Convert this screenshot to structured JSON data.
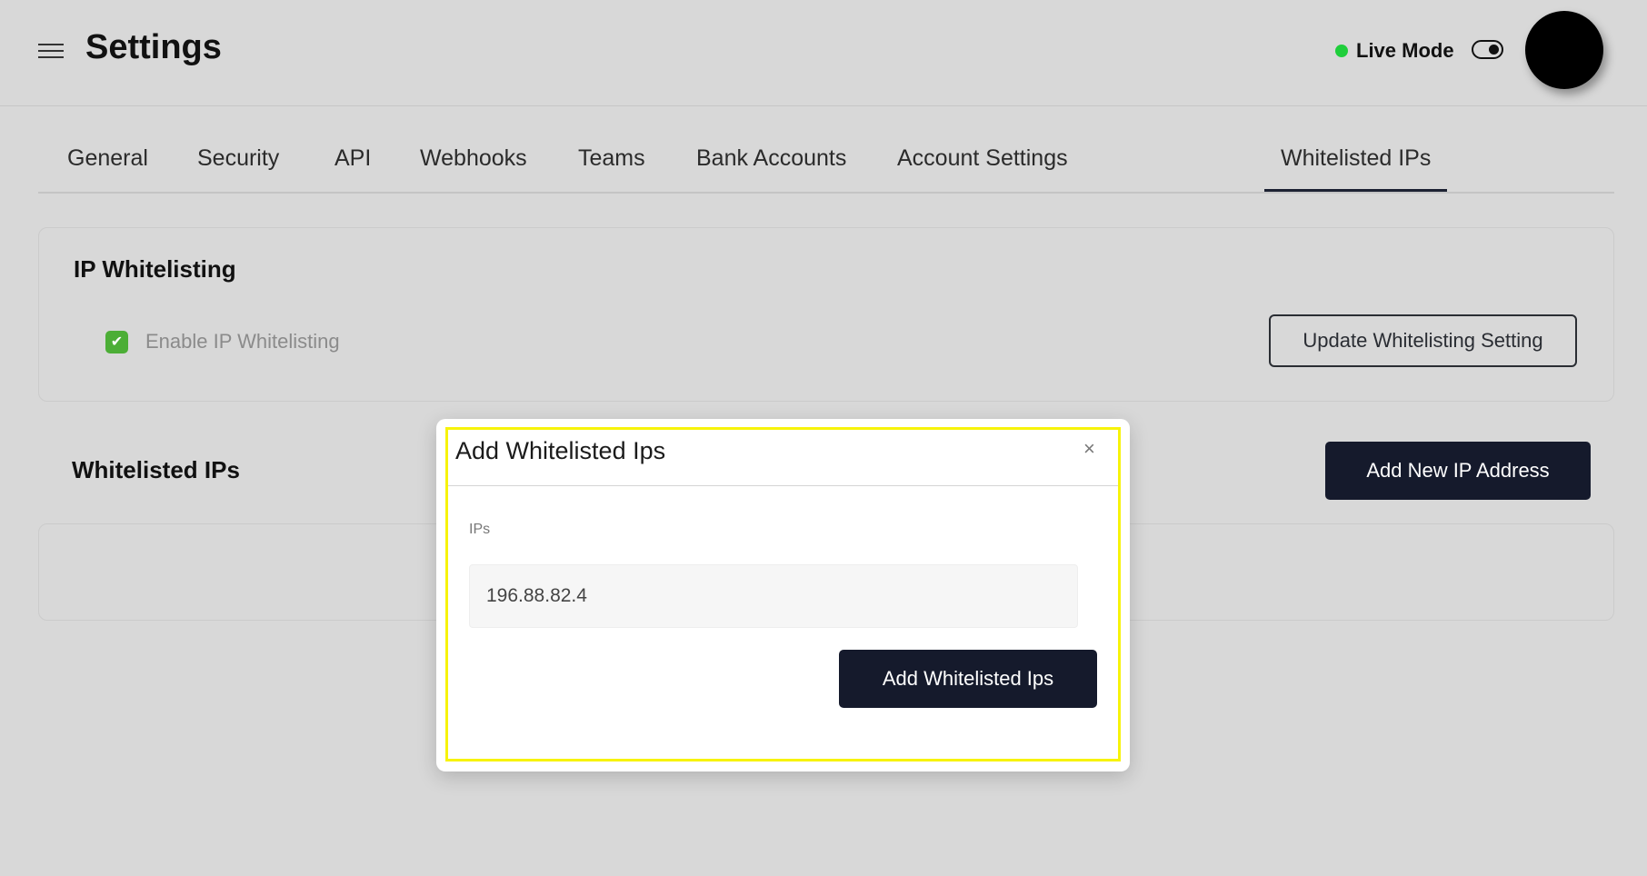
{
  "header": {
    "title": "Settings",
    "menu_icon": "hamburger-menu-icon",
    "live_mode_label": "Live Mode",
    "live_mode_status_color": "#1fce3b",
    "live_mode_on": true
  },
  "tabs": [
    {
      "label": "General",
      "active": false
    },
    {
      "label": "Security",
      "active": false
    },
    {
      "label": "API",
      "active": false
    },
    {
      "label": "Webhooks",
      "active": false
    },
    {
      "label": "Teams",
      "active": false
    },
    {
      "label": "Bank Accounts",
      "active": false
    },
    {
      "label": "Account Settings",
      "active": false
    },
    {
      "label": "Whitelisted IPs",
      "active": true
    }
  ],
  "whitelisting_card": {
    "title": "IP Whitelisting",
    "checkbox_label": "Enable IP Whitelisting",
    "checkbox_checked": true,
    "checkbox_color": "#4cae36",
    "update_button_label": "Update Whitelisting Setting"
  },
  "whitelisted_section": {
    "title": "Whitelisted IPs",
    "add_button_label": "Add New IP Address"
  },
  "modal": {
    "title": "Add Whitelisted Ips",
    "close_glyph": "×",
    "field_label": "IPs",
    "field_value": "196.88.82.4",
    "submit_label": "Add Whitelisted Ips",
    "highlight_color": "#f7f30a"
  },
  "colors": {
    "primary_button": "#151a2c",
    "background": "#d8d8d8"
  }
}
